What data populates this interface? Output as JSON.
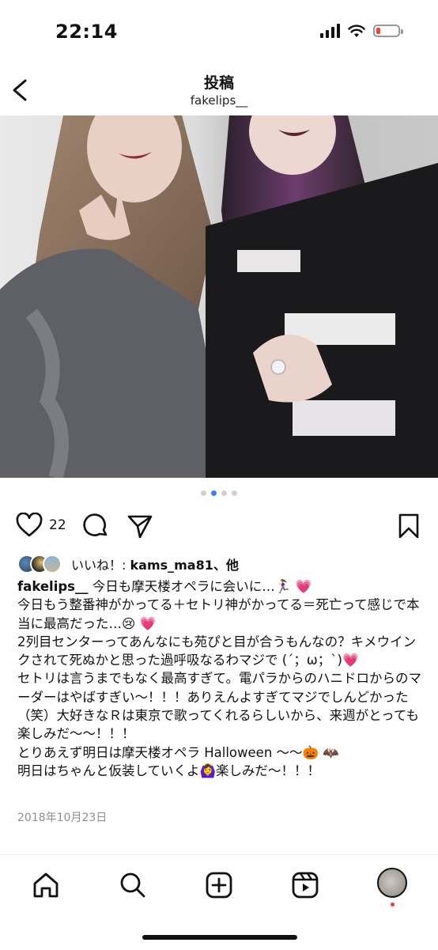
{
  "status_bar": {
    "time": "22:14",
    "battery_color": "#ff3b30"
  },
  "header": {
    "title": "投稿",
    "username": "fakelips__"
  },
  "carousel": {
    "count": 4,
    "active_index": 1,
    "active_color": "#3b82f6"
  },
  "actions": {
    "likes_count": "22",
    "icons": [
      "heart-icon",
      "comment-icon",
      "share-icon",
      "bookmark-icon"
    ]
  },
  "liked_by": {
    "prefix": "いいね！:",
    "user": "kams_ma81",
    "suffix": "、他"
  },
  "post": {
    "username": "fakelips__",
    "caption_first": " 今日も摩天楼オペラに会いに…🏃‍♀️ 💗",
    "caption_rest": "今日もう整番神がかってる＋セトリ神がかってる＝死亡って感じで本当に最高だった…😢 💗\n2列目センターってあんなにも苑ぴと目が合うもんなの？キメウインクされて死ぬかと思った過呼吸なるわマジで (´；ω；`)💗\nセトリは言うまでもなく最高すぎて。電パラからのハニドロからのマーダーはやばすぎい〜！！！ありえんよすぎてマジでしんどかった（笑）大好きなＲは東京で歌ってくれるらしいから、来週がとっても楽しみだ〜〜！！！\nとりあえず明日は摩天楼オペラ Halloween 〜〜🎃 🦇\n明日はちゃんと仮装していくよ🙆‍♀️楽しみだ〜！！！",
    "date": "2018年10月23日"
  },
  "tabbar": {
    "items": [
      "home-icon",
      "search-icon",
      "create-icon",
      "reels-icon",
      "profile-avatar"
    ]
  }
}
